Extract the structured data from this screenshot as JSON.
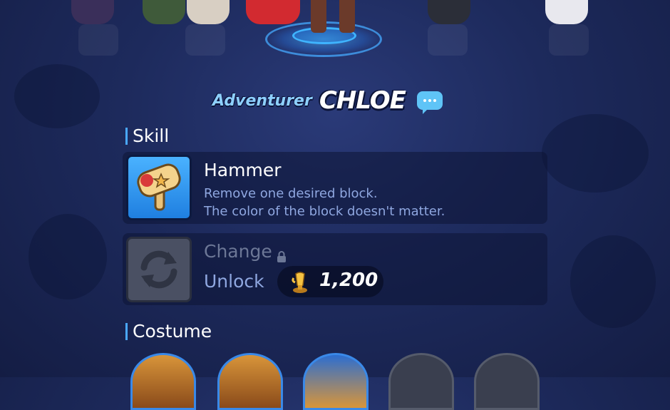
{
  "character": {
    "title_prefix": "Adventurer",
    "name": "CHLOE"
  },
  "icons": {
    "chat": "chat-bubble-icon",
    "skill": "hammer-icon",
    "change": "swap-icon",
    "lock": "lock-icon",
    "currency": "gold-trophy-icon"
  },
  "skill_section": {
    "header": "Skill",
    "skill": {
      "name": "Hammer",
      "description_line1": "Remove one desired block.",
      "description_line2": "The color of the block doesn't matter."
    },
    "change": {
      "label": "Change",
      "unlock_label": "Unlock",
      "cost": "1,200"
    }
  },
  "costume_section": {
    "header": "Costume"
  },
  "colors": {
    "accent": "#4aa8ff",
    "title_prefix": "#8ed0ff",
    "description": "#8fa7e0",
    "disabled": "#6c7796"
  }
}
